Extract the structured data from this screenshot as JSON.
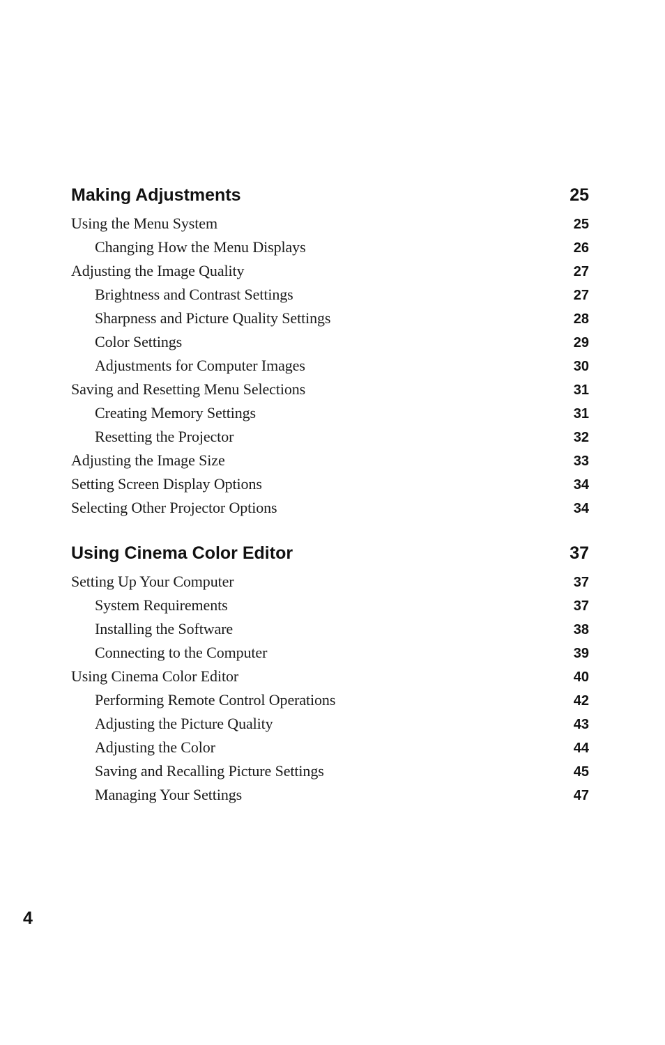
{
  "sections": [
    {
      "title": "Making Adjustments",
      "page": "25",
      "entries": [
        {
          "title": "Using the Menu System",
          "page": "25",
          "level": 1
        },
        {
          "title": "Changing How the Menu Displays",
          "page": "26",
          "level": 2
        },
        {
          "title": "Adjusting the Image Quality",
          "page": "27",
          "level": 1
        },
        {
          "title": "Brightness and Contrast Settings",
          "page": "27",
          "level": 2
        },
        {
          "title": "Sharpness and Picture Quality Settings",
          "page": "28",
          "level": 2
        },
        {
          "title": "Color Settings",
          "page": "29",
          "level": 2
        },
        {
          "title": "Adjustments for Computer Images",
          "page": "30",
          "level": 2
        },
        {
          "title": "Saving and Resetting Menu Selections",
          "page": "31",
          "level": 1
        },
        {
          "title": "Creating Memory Settings",
          "page": "31",
          "level": 2
        },
        {
          "title": "Resetting the Projector",
          "page": "32",
          "level": 2
        },
        {
          "title": "Adjusting the Image Size",
          "page": "33",
          "level": 1
        },
        {
          "title": "Setting Screen Display Options",
          "page": "34",
          "level": 1
        },
        {
          "title": "Selecting Other Projector Options",
          "page": "34",
          "level": 1
        }
      ]
    },
    {
      "title": "Using Cinema Color Editor",
      "page": "37",
      "entries": [
        {
          "title": "Setting Up Your Computer",
          "page": "37",
          "level": 1
        },
        {
          "title": "System Requirements",
          "page": "37",
          "level": 2
        },
        {
          "title": "Installing the Software",
          "page": "38",
          "level": 2
        },
        {
          "title": "Connecting to the Computer",
          "page": "39",
          "level": 2
        },
        {
          "title": "Using Cinema Color Editor",
          "page": "40",
          "level": 1
        },
        {
          "title": "Performing Remote Control Operations",
          "page": "42",
          "level": 2
        },
        {
          "title": "Adjusting the Picture Quality",
          "page": "43",
          "level": 2
        },
        {
          "title": "Adjusting the Color",
          "page": "44",
          "level": 2
        },
        {
          "title": "Saving and Recalling Picture Settings",
          "page": "45",
          "level": 2
        },
        {
          "title": "Managing Your Settings",
          "page": "47",
          "level": 2
        }
      ]
    }
  ],
  "footer": {
    "page_number": "4"
  }
}
